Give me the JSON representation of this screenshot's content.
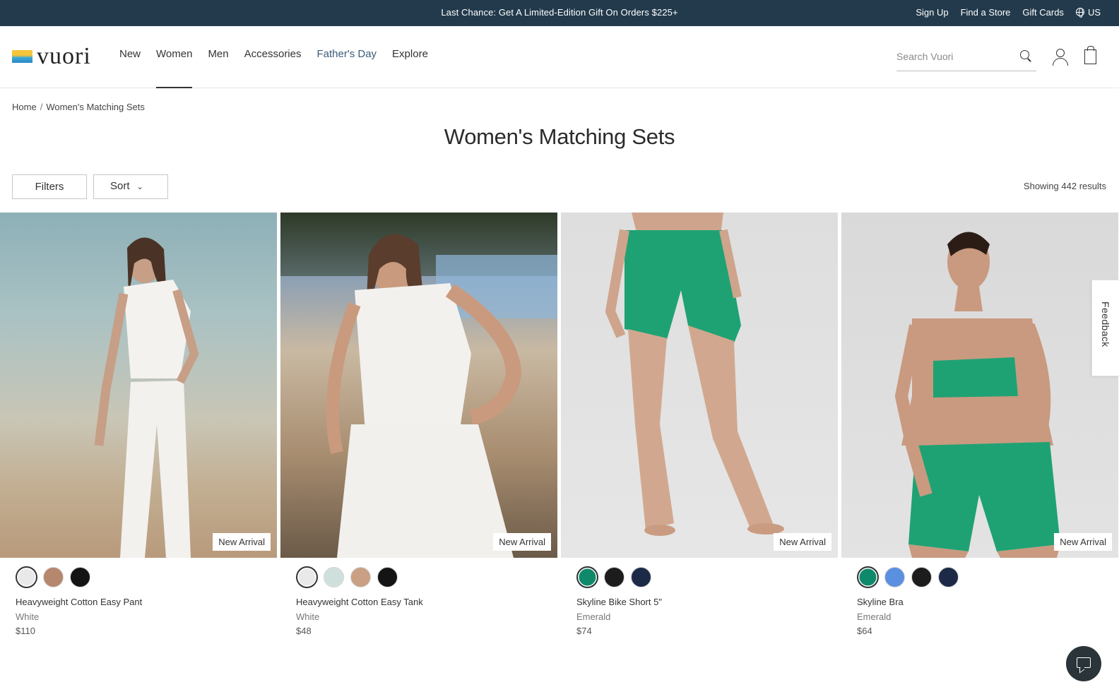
{
  "announcement": {
    "promo": "Last Chance: Get A Limited-Edition Gift On Orders $225+",
    "sign_up": "Sign Up",
    "find_store": "Find a Store",
    "gift_cards": "Gift Cards",
    "region": "US"
  },
  "header": {
    "logo_text": "vuori",
    "nav": {
      "new": "New",
      "women": "Women",
      "men": "Men",
      "accessories": "Accessories",
      "fathers_day": "Father's Day",
      "explore": "Explore"
    },
    "search_placeholder": "Search Vuori"
  },
  "breadcrumb": {
    "home": "Home",
    "separator": "/",
    "current": "Women's Matching Sets"
  },
  "page_title": "Women's Matching Sets",
  "toolbar": {
    "filters_label": "Filters",
    "sort_label": "Sort",
    "results_text": "Showing 442 results"
  },
  "products": [
    {
      "name": "Heavyweight Cotton Easy Pant",
      "color": "White",
      "price": "$110",
      "badge": "New Arrival",
      "swatches": [
        "#e9e9e9",
        "#b5876d",
        "#141414"
      ]
    },
    {
      "name": "Heavyweight Cotton Easy Tank",
      "color": "White",
      "price": "$48",
      "badge": "New Arrival",
      "swatches": [
        "#e9e9e9",
        "#cfe0dc",
        "#c9a083",
        "#141414"
      ]
    },
    {
      "name": "Skyline Bike Short 5\"",
      "color": "Emerald",
      "price": "$74",
      "badge": "New Arrival",
      "swatches": [
        "#0e8a6b",
        "#1c1c1c",
        "#1d2a47"
      ]
    },
    {
      "name": "Skyline Bra",
      "color": "Emerald",
      "price": "$64",
      "badge": "New Arrival",
      "swatches": [
        "#0e8a6b",
        "#5b8fe0",
        "#1c1c1c",
        "#1d2a47"
      ]
    }
  ],
  "feedback_label": "Feedback",
  "colors": {
    "announcement_bg": "#223a4c",
    "fathers_day_link": "#3a5b7a",
    "emerald": "#1ea06f"
  }
}
